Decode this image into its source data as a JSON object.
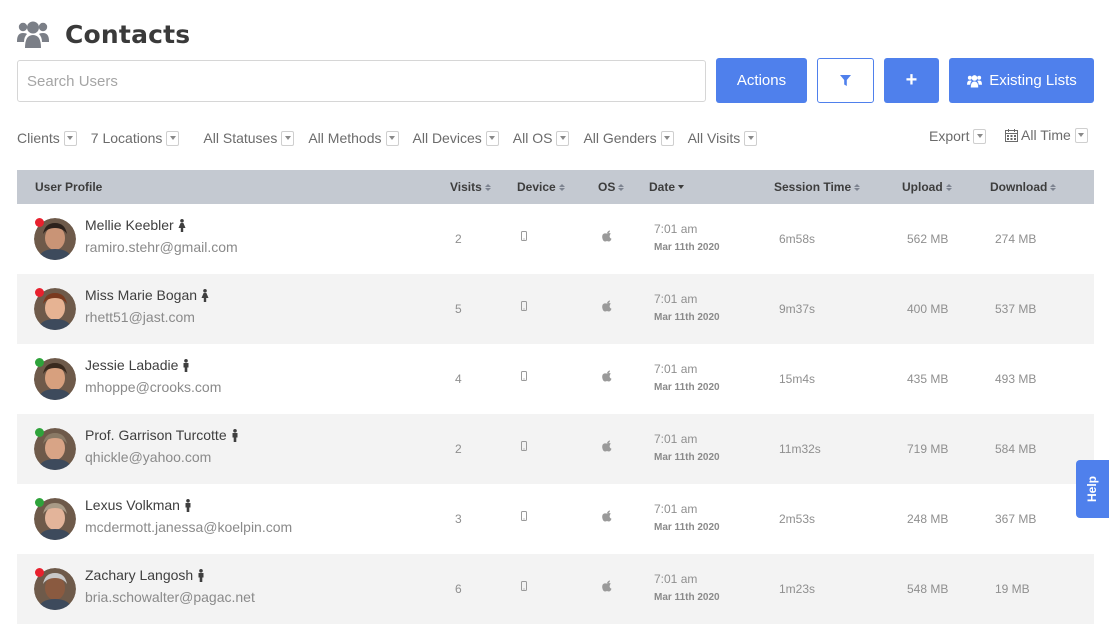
{
  "header": {
    "title": "Contacts",
    "icon": "users-icon"
  },
  "search": {
    "placeholder": "Search Users",
    "value": ""
  },
  "buttons": {
    "actions_label": "Actions",
    "filter_icon": "funnel-icon",
    "add_label": "+",
    "existing_lists_label": "Existing Lists",
    "accent": "#4f80ec"
  },
  "filters": [
    "Clients",
    "7 Locations",
    "All Statuses",
    "All Methods",
    "All Devices",
    "All OS",
    "All Genders",
    "All Visits"
  ],
  "export_label": "Export",
  "time_range_label": "All Time",
  "columns": {
    "profile": "User Profile",
    "visits": "Visits",
    "device": "Device",
    "os": "OS",
    "date": "Date",
    "session": "Session Time",
    "upload": "Upload",
    "download": "Download"
  },
  "status_colors": {
    "offline": "#e8212e",
    "online": "#2fa33b"
  },
  "rows": [
    {
      "name": "Mellie Keebler",
      "gender": "female",
      "email": "ramiro.stehr@gmail.com",
      "status": "offline",
      "visits": "2",
      "time": "7:01 am",
      "date": "Mar 11th 2020",
      "session": "6m58s",
      "upload": "562 MB",
      "download": "274 MB"
    },
    {
      "name": "Miss Marie Bogan",
      "gender": "female",
      "email": "rhett51@jast.com",
      "status": "offline",
      "visits": "5",
      "time": "7:01 am",
      "date": "Mar 11th 2020",
      "session": "9m37s",
      "upload": "400 MB",
      "download": "537 MB"
    },
    {
      "name": "Jessie Labadie",
      "gender": "male",
      "email": "mhoppe@crooks.com",
      "status": "online",
      "visits": "4",
      "time": "7:01 am",
      "date": "Mar 11th 2020",
      "session": "15m4s",
      "upload": "435 MB",
      "download": "493 MB"
    },
    {
      "name": "Prof. Garrison Turcotte",
      "gender": "male",
      "email": "qhickle@yahoo.com",
      "status": "online",
      "visits": "2",
      "time": "7:01 am",
      "date": "Mar 11th 2020",
      "session": "11m32s",
      "upload": "719 MB",
      "download": "584 MB"
    },
    {
      "name": "Lexus Volkman",
      "gender": "male",
      "email": "mcdermott.janessa@koelpin.com",
      "status": "online",
      "visits": "3",
      "time": "7:01 am",
      "date": "Mar 11th 2020",
      "session": "2m53s",
      "upload": "248 MB",
      "download": "367 MB"
    },
    {
      "name": "Zachary Langosh",
      "gender": "male",
      "email": "bria.schowalter@pagac.net",
      "status": "offline",
      "visits": "6",
      "time": "7:01 am",
      "date": "Mar 11th 2020",
      "session": "1m23s",
      "upload": "548 MB",
      "download": "19 MB"
    }
  ],
  "help_label": "Help"
}
